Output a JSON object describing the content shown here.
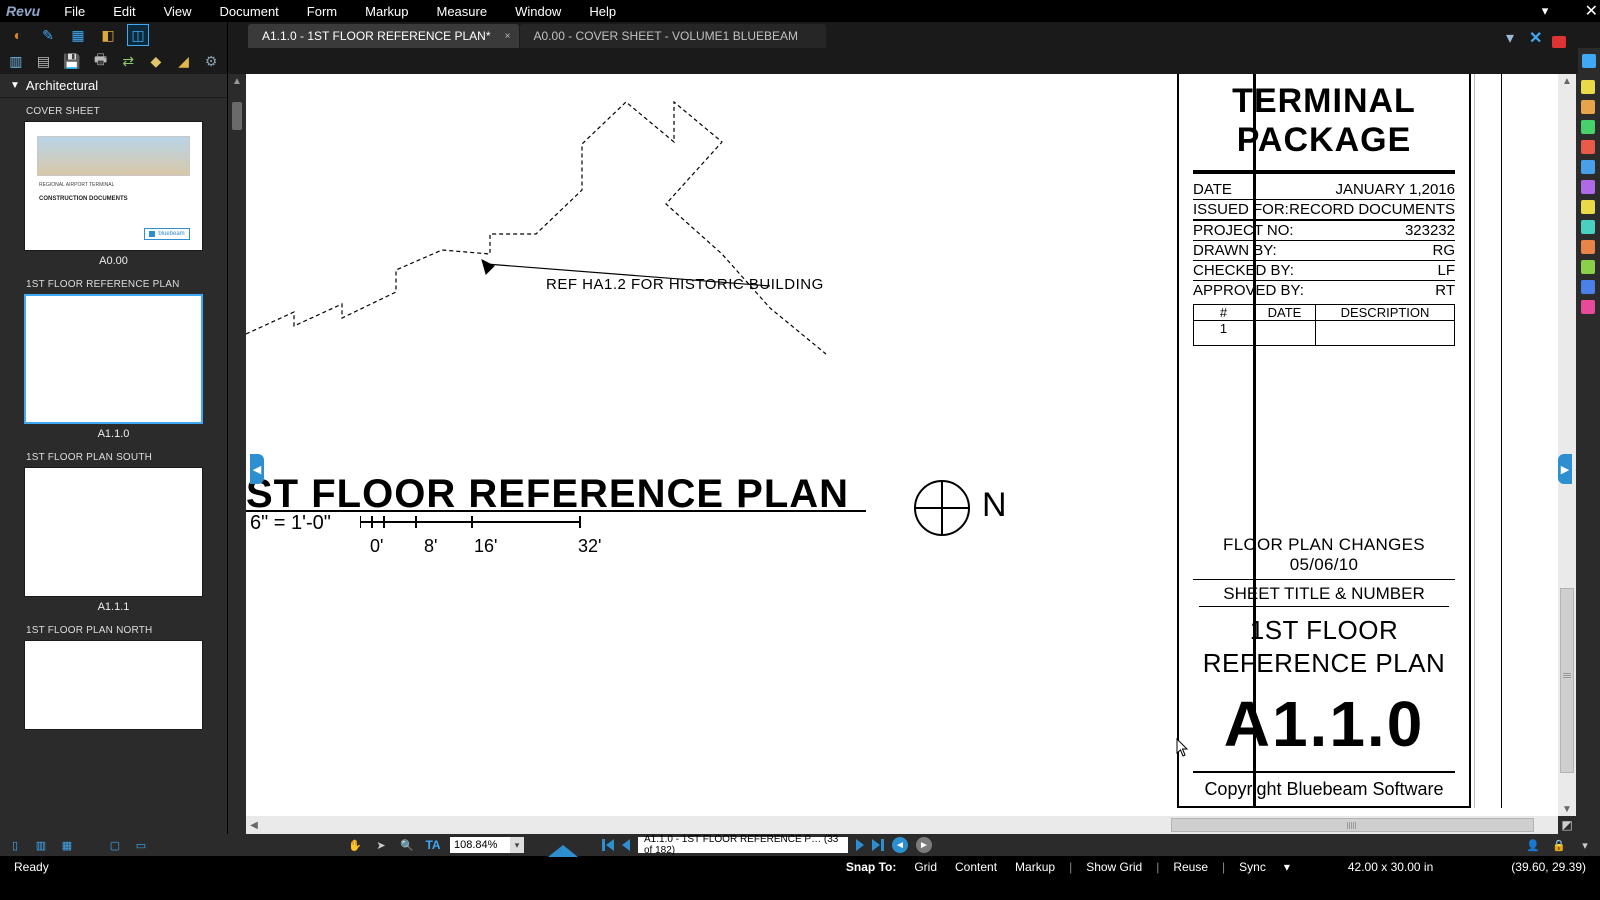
{
  "window": {
    "min": "—",
    "max": "❐",
    "close": "✕",
    "dd": "▾"
  },
  "menu": {
    "logo": "Revu",
    "items": [
      "File",
      "Edit",
      "View",
      "Document",
      "Form",
      "Markup",
      "Measure",
      "Window",
      "Help"
    ]
  },
  "tabs": {
    "active": "A1.1.0 - 1ST FLOOR  REFERENCE PLAN*",
    "inactive": "A0.00 - COVER SHEET - VOLUME1 BLUEBEAM"
  },
  "side": {
    "group": "Architectural",
    "thumbs": [
      {
        "hdr": "COVER SHEET",
        "label": "A0.00",
        "cover": true,
        "t1": "REGIONAL AIRPORT TERMINAL",
        "t2": "CONSTRUCTION DOCUMENTS",
        "bb": "bluebeam"
      },
      {
        "hdr": "1ST FLOOR REFERENCE PLAN",
        "label": "A1.1.0",
        "selected": true
      },
      {
        "hdr": "1ST FLOOR PLAN SOUTH",
        "label": "A1.1.1"
      },
      {
        "hdr": "1ST FLOOR PLAN NORTH",
        "label": ""
      }
    ]
  },
  "drawing": {
    "callout": "REF HA1.2 FOR HISTORIC BUILDING",
    "title": "ST FLOOR REFERENCE PLAN",
    "scale": "6\" = 1'-0\"",
    "ticks": [
      "0'",
      "8'",
      "16'",
      "32'"
    ],
    "north": "N"
  },
  "tb": {
    "h1a": "TERMINAL",
    "h1b": "PACKAGE",
    "rows": [
      [
        "DATE",
        "JANUARY 1,2016"
      ],
      [
        "ISSUED FOR:",
        "RECORD DOCUMENTS"
      ],
      [
        "PROJECT NO:",
        "323232"
      ],
      [
        "DRAWN BY:",
        "RG"
      ],
      [
        "CHECKED BY:",
        "LF"
      ],
      [
        "APPROVED BY:",
        "RT"
      ]
    ],
    "rev_hdr": [
      "#",
      "DATE",
      "DESCRIPTION"
    ],
    "rev_row1": "1",
    "changes": "FLOOR PLAN CHANGES 05/06/10",
    "sub": "SHEET TITLE & NUMBER",
    "sheettitle1": "1ST FLOOR",
    "sheettitle2": "REFERENCE PLAN",
    "sheetnum": "A1.1.0",
    "copy": "Copyright Bluebeam Software"
  },
  "nav": {
    "zoom": "108.84%",
    "page": "A1.1.0 - 1ST FLOOR  REFERENCE P…  (33 of 182)"
  },
  "status": {
    "ready": "Ready",
    "snap": "Snap To:",
    "grid": "Grid",
    "content": "Content",
    "markup": "Markup",
    "showgrid": "Show Grid",
    "reuse": "Reuse",
    "sync": "Sync",
    "dims": "42.00 x 30.00 in",
    "coords": "(39.60, 29.39)"
  }
}
